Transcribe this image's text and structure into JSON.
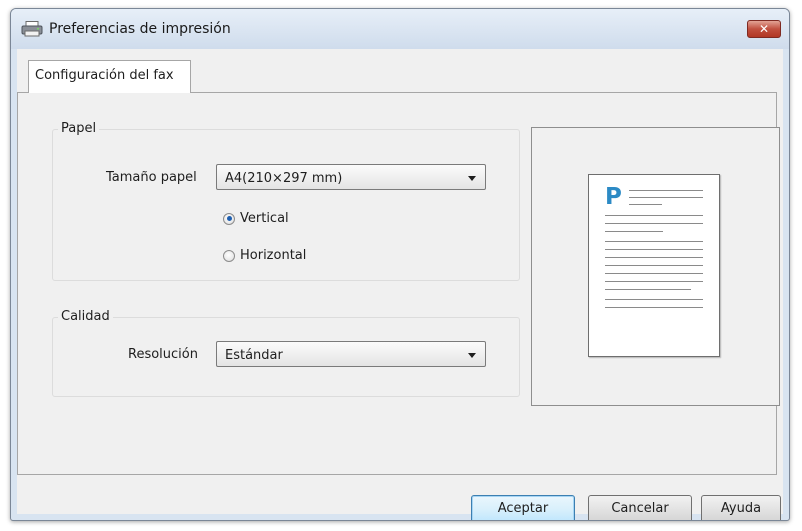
{
  "window": {
    "title": "Preferencias de impresión",
    "close_glyph": "✕"
  },
  "tabs": [
    {
      "label": "Configuración del fax",
      "active": true
    }
  ],
  "paper": {
    "legend": "Papel",
    "size_label": "Tamaño papel",
    "size_value": "A4(210×297 mm)",
    "orientation_options": [
      {
        "label": "Vertical",
        "checked": true
      },
      {
        "label": "Horizontal",
        "checked": false
      }
    ]
  },
  "quality": {
    "legend": "Calidad",
    "resolution_label": "Resolución",
    "resolution_value": "Estándar"
  },
  "preview": {
    "page_letter": "P",
    "accent_color": "#2c8ac5"
  },
  "buttons": {
    "ok": "Aceptar",
    "cancel": "Cancelar",
    "help": "Ayuda"
  }
}
